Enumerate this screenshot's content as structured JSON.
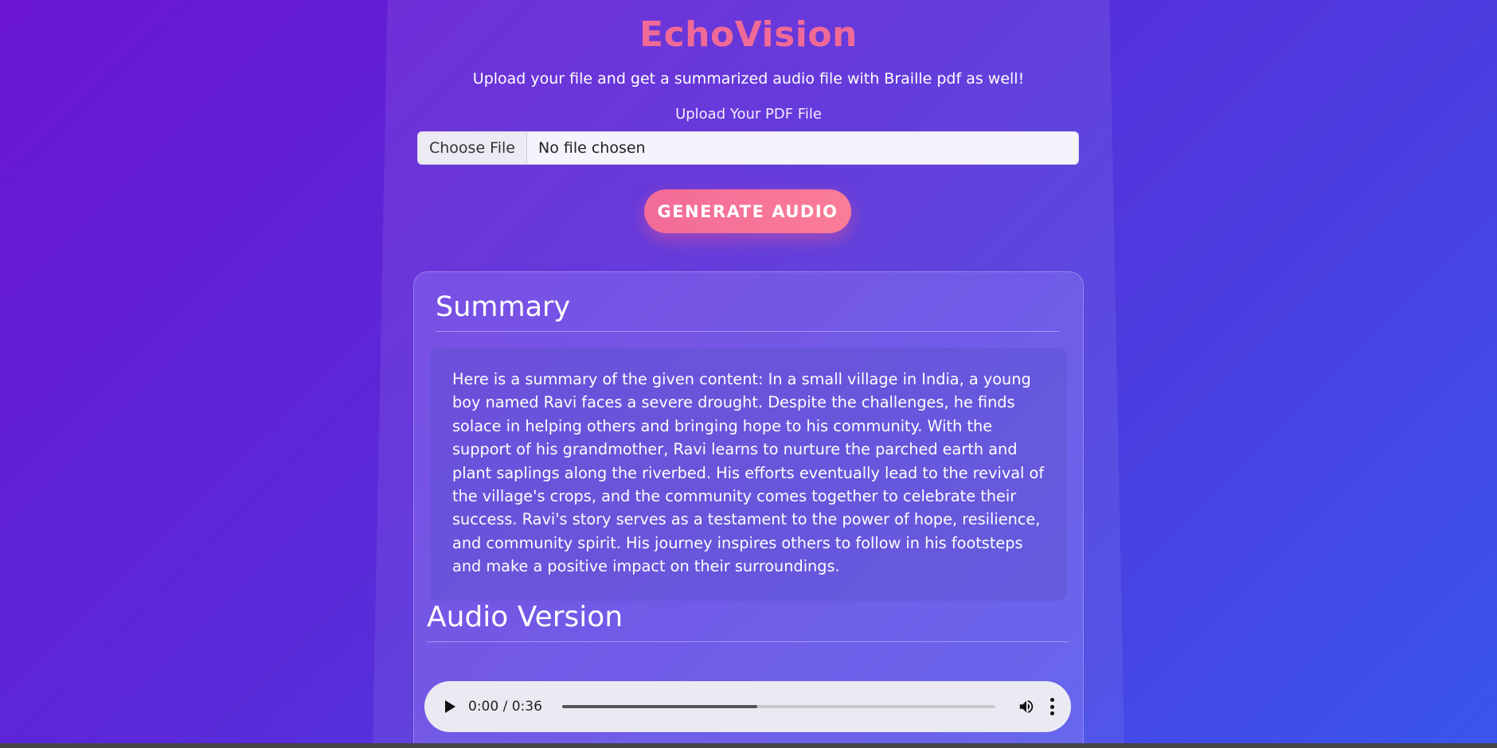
{
  "app": {
    "title": "EchoVision",
    "subtitle": "Upload your file and get a summarized audio file with Braille pdf as well!"
  },
  "upload": {
    "label": "Upload Your PDF File",
    "choose_label": "Choose File",
    "status": "No file chosen"
  },
  "generate_button": "GENERATE AUDIO",
  "summary": {
    "heading": "Summary",
    "text": "Here is a summary of the given content: In a small village in India, a young boy named Ravi faces a severe drought. Despite the challenges, he finds solace in helping others and bringing hope to his community. With the support of his grandmother, Ravi learns to nurture the parched earth and plant saplings along the riverbed. His efforts eventually lead to the revival of the village's crops, and the community comes together to celebrate their success. Ravi's story serves as a testament to the power of hope, resilience, and community spirit. His journey inspires others to follow in his footsteps and make a positive impact on their surroundings."
  },
  "audio": {
    "heading": "Audio Version",
    "time": "0:00 / 0:36",
    "progress_fraction": 0.45
  },
  "icons": {
    "play": "play-icon",
    "volume": "volume-icon",
    "more": "more-vertical-icon"
  },
  "colors": {
    "title": "#f06a97",
    "button": "#f26b98"
  }
}
